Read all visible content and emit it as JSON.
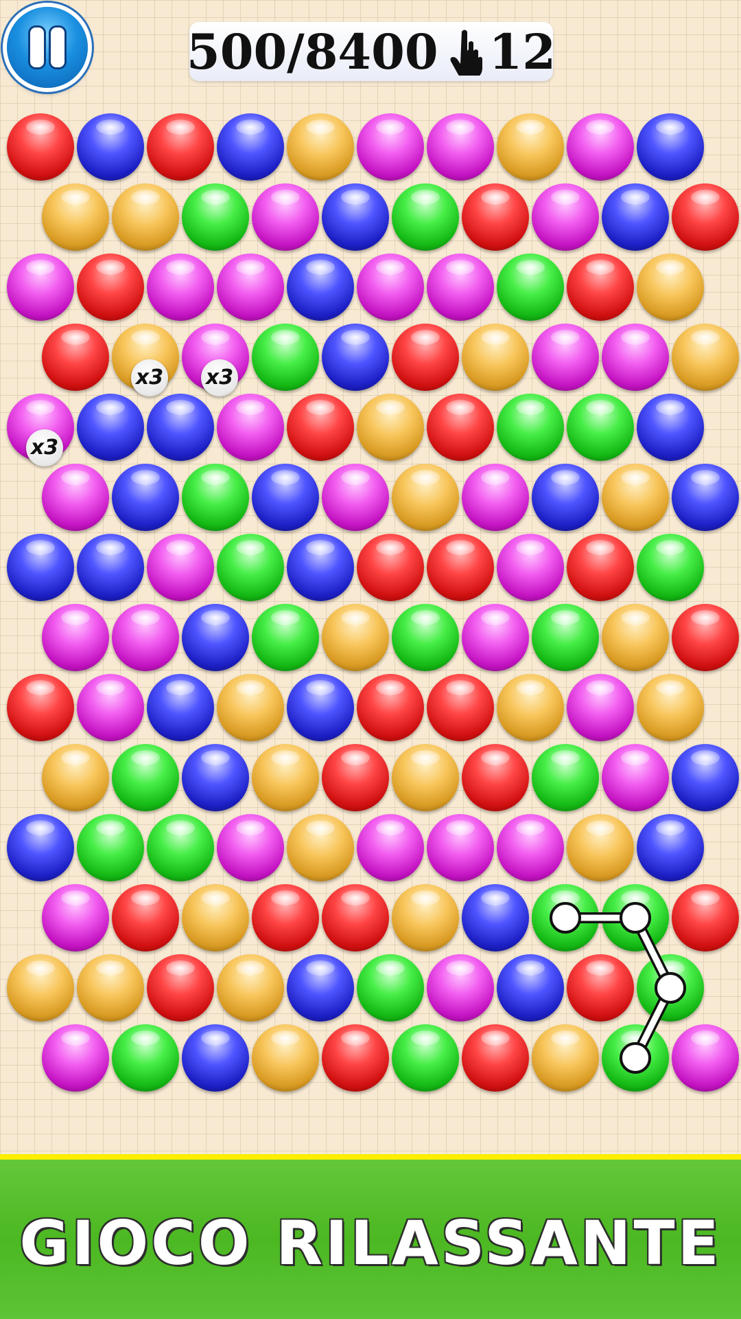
{
  "hud": {
    "score_current": "500",
    "score_target": "8400",
    "score_text": "500/8400",
    "moves_left": "12",
    "pause_icon": "pause-icon",
    "moves_icon": "hand-pointer-icon"
  },
  "grid": {
    "rows": [
      [
        "red",
        "blue",
        "red",
        "blue",
        "orange",
        "magenta",
        "magenta",
        "orange",
        "magenta",
        "blue"
      ],
      [
        "orange",
        "orange",
        "green",
        "magenta",
        "blue",
        "green",
        "red",
        "magenta",
        "blue",
        "red"
      ],
      [
        "magenta",
        "red",
        "magenta",
        "magenta",
        "blue",
        "magenta",
        "magenta",
        "green",
        "red",
        "orange"
      ],
      [
        "red",
        "orange",
        "magenta",
        "green",
        "blue",
        "red",
        "orange",
        "magenta",
        "magenta",
        "orange"
      ],
      [
        "magenta",
        "blue",
        "blue",
        "magenta",
        "red",
        "orange",
        "red",
        "green",
        "green",
        "blue"
      ],
      [
        "magenta",
        "blue",
        "green",
        "blue",
        "magenta",
        "orange",
        "magenta",
        "blue",
        "orange",
        "blue"
      ],
      [
        "blue",
        "blue",
        "magenta",
        "green",
        "blue",
        "red",
        "red",
        "magenta",
        "red",
        "green"
      ],
      [
        "magenta",
        "magenta",
        "blue",
        "green",
        "orange",
        "green",
        "magenta",
        "green",
        "orange",
        "red"
      ],
      [
        "red",
        "magenta",
        "blue",
        "orange",
        "blue",
        "red",
        "red",
        "orange",
        "magenta",
        "orange"
      ],
      [
        "orange",
        "green",
        "blue",
        "orange",
        "red",
        "orange",
        "red",
        "green",
        "magenta",
        "blue"
      ],
      [
        "blue",
        "green",
        "green",
        "magenta",
        "orange",
        "magenta",
        "magenta",
        "magenta",
        "orange",
        "blue"
      ],
      [
        "magenta",
        "red",
        "orange",
        "red",
        "red",
        "orange",
        "blue",
        "green",
        "green",
        "red"
      ],
      [
        "orange",
        "orange",
        "red",
        "orange",
        "blue",
        "green",
        "magenta",
        "blue",
        "red",
        "green"
      ],
      [
        "magenta",
        "green",
        "blue",
        "orange",
        "red",
        "green",
        "red",
        "orange",
        "green",
        "magenta"
      ]
    ],
    "multipliers": [
      {
        "row": 3,
        "col": 1,
        "label": "x3"
      },
      {
        "row": 3,
        "col": 2,
        "label": "x3"
      },
      {
        "row": 4,
        "col": 0,
        "label": "x3"
      }
    ],
    "selection_chain": [
      [
        11,
        7
      ],
      [
        11,
        8
      ],
      [
        12,
        9
      ],
      [
        13,
        8
      ]
    ]
  },
  "colors": {
    "accent_yellow": "#ffee00",
    "banner_green": "#4cb822"
  },
  "banner": {
    "title": "GIOCO RILASSANTE"
  }
}
